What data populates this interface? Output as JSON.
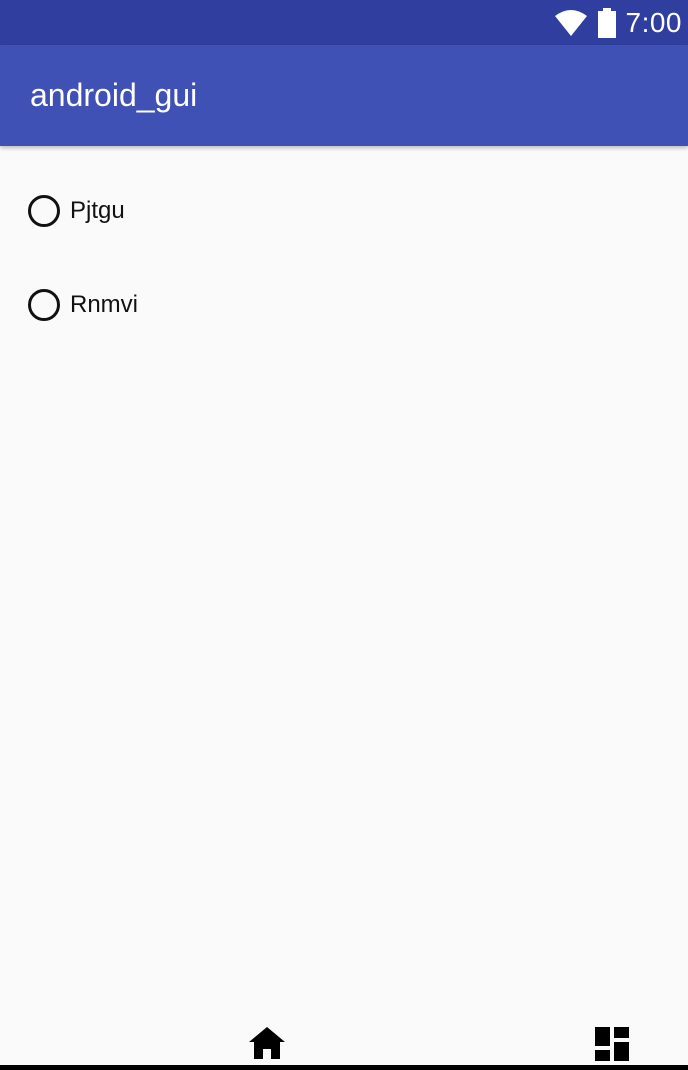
{
  "status_bar": {
    "time": "7:00",
    "icons": [
      "wifi-icon",
      "battery-icon"
    ],
    "background_color": "#303f9f"
  },
  "app_bar": {
    "title": "android_gui",
    "background_color": "#3f51b5"
  },
  "radio_group": {
    "options": [
      {
        "label": "Pjtgu",
        "selected": false
      },
      {
        "label": "Rnmvi",
        "selected": false
      }
    ]
  },
  "nav_bar": {
    "icons": [
      "home-icon",
      "dashboard-icon"
    ]
  }
}
